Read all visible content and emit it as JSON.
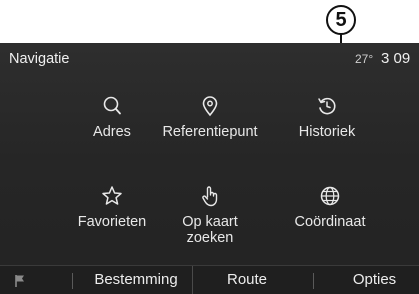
{
  "callout": {
    "number": "5"
  },
  "header": {
    "title": "Navigatie",
    "temperature": "27°",
    "clock": "3 09"
  },
  "menu": {
    "items": [
      {
        "label": "Adres",
        "icon": "search-icon"
      },
      {
        "label": "Referentiepunt",
        "icon": "location-pin-icon"
      },
      {
        "label": "Historiek",
        "icon": "history-clock-icon"
      },
      {
        "label": "Favorieten",
        "icon": "star-icon"
      },
      {
        "label_line1": "Op kaart",
        "label_line2": "zoeken",
        "icon": "hand-pointer-icon"
      },
      {
        "label": "Coördinaat",
        "icon": "globe-icon"
      }
    ]
  },
  "tabs": {
    "destination": "Bestemming",
    "route": "Route",
    "options": "Opties",
    "flag_icon": "flag-icon"
  },
  "colors": {
    "screen_background": "#262626",
    "text": "#e8e8e8",
    "bottom_bar": "#1f1f1f"
  }
}
